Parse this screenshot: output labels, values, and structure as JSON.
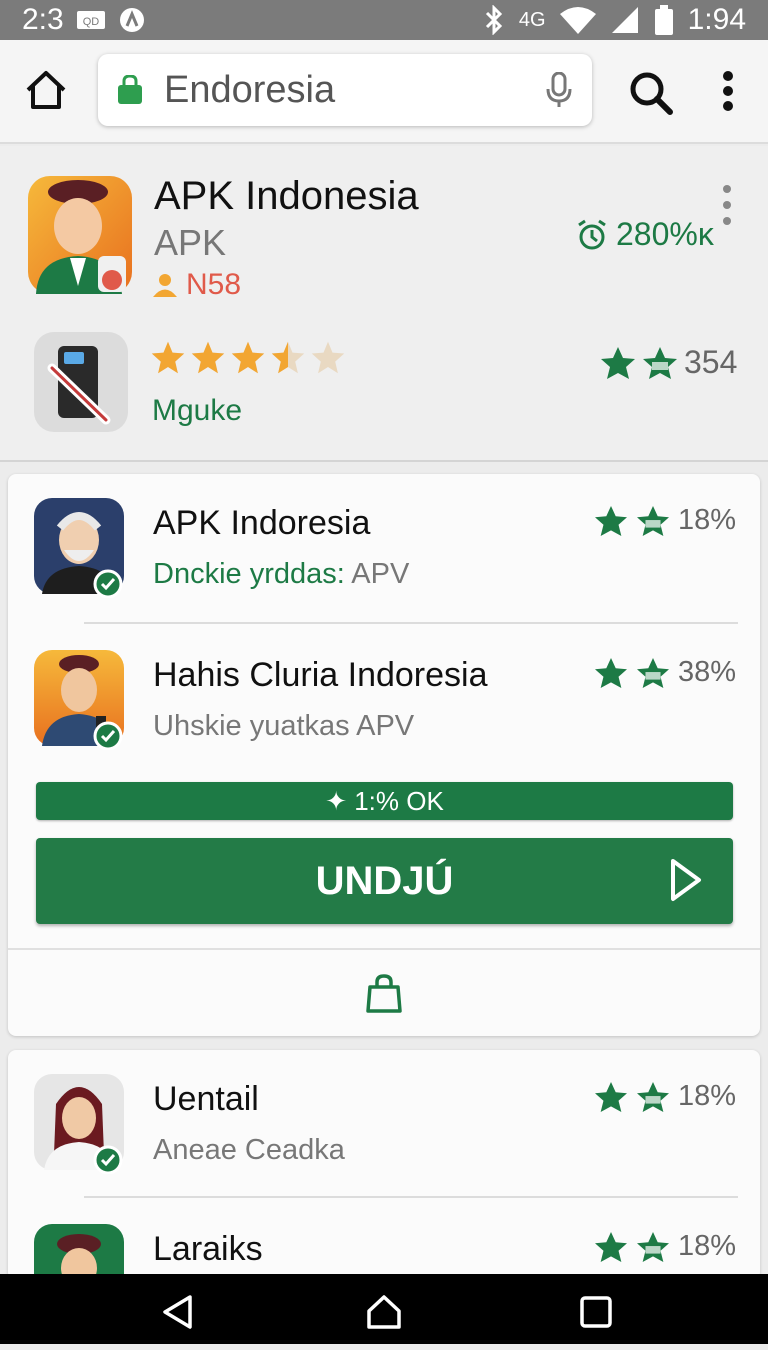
{
  "status_bar": {
    "time_left": "2:3",
    "signal_text": "4G",
    "time_right": "1:94"
  },
  "browser": {
    "url_text": "Endoresia",
    "icons": [
      "home-icon",
      "lock-icon",
      "mic-icon",
      "search-icon",
      "more-vert-icon"
    ]
  },
  "hero": {
    "title": "APK Indonesia",
    "subtitle": "APK",
    "owner_label": "N58",
    "download_stat": "280%κ",
    "tag": "Mguke",
    "rating_value": 3.5,
    "rating_max": 5,
    "rating_count": "354"
  },
  "list": [
    {
      "name": "APK Indoresia",
      "sub_lead": "Dnckie yrddas:",
      "sub_tail": " APV",
      "rate": "18%"
    },
    {
      "name": "Hahis Cluria Indoresia",
      "sub_lead": "Uhskie yuatkas APV",
      "sub_tail": "",
      "rate": "38%"
    },
    {
      "name": "Uentail",
      "sub_lead": "Aneae Ceadka",
      "sub_tail": "",
      "rate": "18%"
    },
    {
      "name": "Laraiks",
      "sub_lead": "",
      "sub_tail": "",
      "rate": "18%"
    }
  ],
  "progress": {
    "label": "✦ 1:% OK"
  },
  "download_button": {
    "label": "UNDJÚ"
  },
  "colors": {
    "accent": "#1d7a45",
    "owner": "#e05a4a",
    "star": "#f2a632"
  }
}
